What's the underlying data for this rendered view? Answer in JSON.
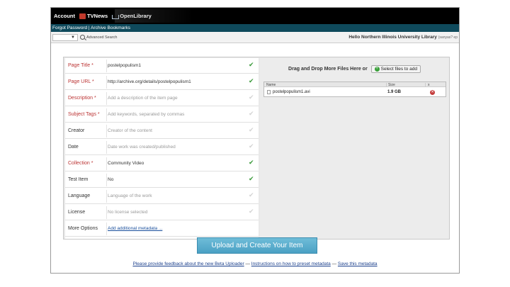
{
  "topbar": {
    "account": "Account",
    "tvnews": "TVNews",
    "openlibrary": "OpenLibrary"
  },
  "subbar": {
    "links": "Forgot Password | Archive Bookmarks"
  },
  "searchrow": {
    "advanced": "Advanced Search",
    "hello": "Hello Northern Illinois University Library",
    "hello_small": "(sanyas? ep"
  },
  "form": {
    "rows": [
      {
        "label": "Page Title",
        "required": true,
        "value": "postelpopulism1",
        "placeholder": false,
        "check": "green"
      },
      {
        "label": "Page URL",
        "required": true,
        "value": "http://archive.org/details/postelpopulism1",
        "placeholder": false,
        "check": "green"
      },
      {
        "label": "Description",
        "required": true,
        "value": "Add a description of the item page",
        "placeholder": true,
        "check": "dim"
      },
      {
        "label": "Subject Tags",
        "required": true,
        "value": "Add keywords, separated by commas",
        "placeholder": true,
        "check": "dim"
      },
      {
        "label": "Creator",
        "required": false,
        "value": "Creator of the content",
        "placeholder": true,
        "check": "dim"
      },
      {
        "label": "Date",
        "required": false,
        "value": "Date work was created/published",
        "placeholder": true,
        "check": "dim"
      },
      {
        "label": "Collection",
        "required": true,
        "value": "Community Video",
        "placeholder": false,
        "check": "green"
      },
      {
        "label": "Test Item",
        "required": false,
        "value": "No",
        "placeholder": false,
        "check": "green"
      },
      {
        "label": "Language",
        "required": false,
        "value": "Language of the work",
        "placeholder": true,
        "check": "dim"
      },
      {
        "label": "License",
        "required": false,
        "value": "No license selected",
        "placeholder": true,
        "check": "dim"
      },
      {
        "label": "More Options",
        "required": false,
        "value": "Add additional metadata ...",
        "placeholder": false,
        "link": true,
        "check": "none"
      }
    ]
  },
  "files": {
    "dnd_text": "Drag and Drop More Files Here or",
    "select_button": "Select files to add",
    "col_name": "Name",
    "col_size": "Size",
    "col_x": "x",
    "file_name": "postelpopulism1.avi",
    "file_size": "1.9 GB"
  },
  "upload_button": "Upload and Create Your Item",
  "footer": {
    "feedback": "Please provide feedback about the new Beta Uploader",
    "sep1": "—",
    "instructions": "Instructions on how to preset metadata",
    "sep2": "—",
    "save": "Save this metadata"
  },
  "colors": {
    "topbar": "#000000",
    "subbar": "#0f4a5c",
    "upload_button": "#5aaed0",
    "required_label": "#bb3333",
    "check": "#3a9a3a"
  }
}
